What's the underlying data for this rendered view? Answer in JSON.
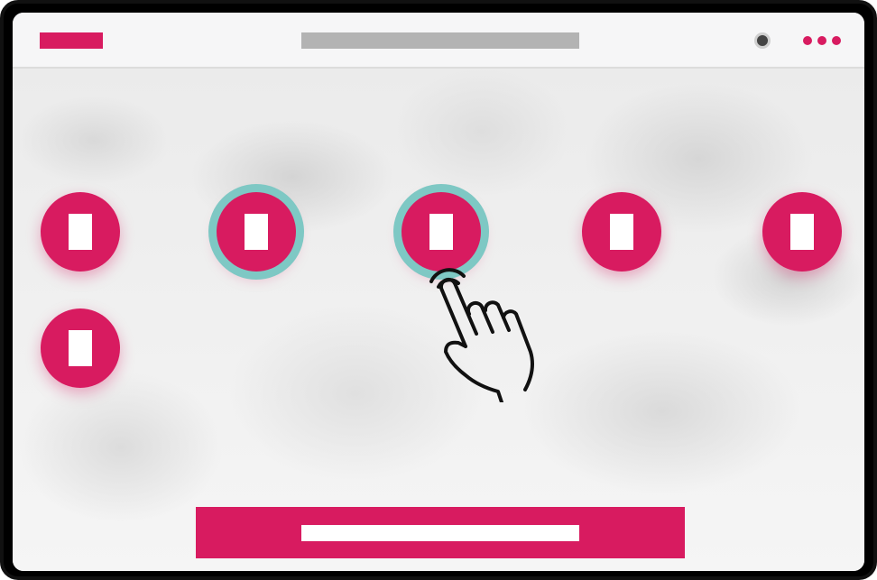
{
  "colors": {
    "accent": "#d81b60",
    "selection_ring": "#7ec8c4",
    "placeholder_gray": "#b3b3b3",
    "frame": "#111111"
  },
  "topbar": {
    "logo_icon": "logo-placeholder",
    "title_placeholder": "title-placeholder",
    "record_icon": "record-dot-icon",
    "menu_icon": "more-horizontal-icon"
  },
  "grid": {
    "items": [
      {
        "icon": "document-icon",
        "selected": false
      },
      {
        "icon": "document-icon",
        "selected": true
      },
      {
        "icon": "document-icon",
        "selected": true
      },
      {
        "icon": "document-icon",
        "selected": false
      },
      {
        "icon": "document-icon",
        "selected": false
      },
      {
        "icon": "document-icon",
        "selected": false
      }
    ]
  },
  "gesture": {
    "icon": "tap-hand-icon"
  },
  "action_bar": {
    "icon": "label-placeholder"
  }
}
